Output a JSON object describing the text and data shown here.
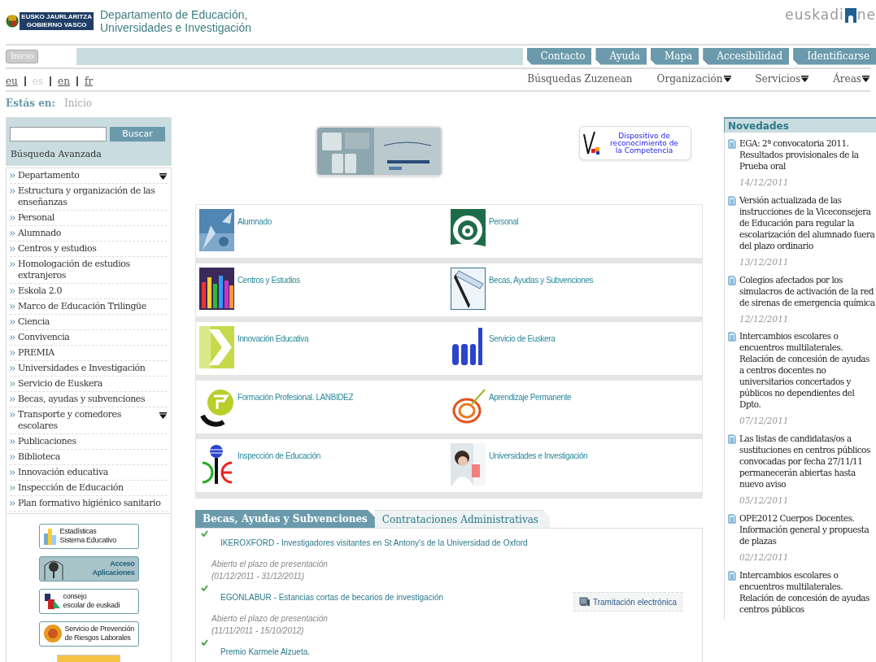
{
  "header": {
    "logo_lines": [
      "EUSKO JAURLARITZA",
      "GOBIERNO VASCO"
    ],
    "title_lines": [
      "Departamento de Educación,",
      "Universidades e Investigación"
    ],
    "brand": [
      "euskadi",
      "ne"
    ]
  },
  "top_nav": {
    "home": "Inicio",
    "links": [
      "Contacto",
      "Ayuda",
      "Mapa",
      "Accesibilidad",
      "Identificarse"
    ]
  },
  "languages": [
    {
      "label": "eu",
      "selected": false
    },
    {
      "label": "es",
      "selected": true
    },
    {
      "label": "en",
      "selected": false
    },
    {
      "label": "fr",
      "selected": false
    }
  ],
  "secondary_nav": [
    {
      "label": "Búsquedas Zuzenean",
      "dropdown": false
    },
    {
      "label": "Organización",
      "dropdown": true
    },
    {
      "label": "Servicios",
      "dropdown": true
    },
    {
      "label": "Áreas",
      "dropdown": true
    }
  ],
  "breadcrumb": {
    "label": "Estás en:",
    "items": [
      "Inicio"
    ]
  },
  "search": {
    "button": "Buscar",
    "advanced": "Búsqueda Avanzada"
  },
  "sidebar": {
    "items": [
      {
        "label": "Departamento",
        "dropdown": true
      },
      {
        "label": "Estructura y organización de las enseñanzas",
        "dropdown": false
      },
      {
        "label": "Personal",
        "dropdown": false
      },
      {
        "label": "Alumnado",
        "dropdown": false
      },
      {
        "label": "Centros y estudios",
        "dropdown": false
      },
      {
        "label": "Homologación de estudios extranjeros",
        "dropdown": false
      },
      {
        "label": "Eskola 2.0",
        "dropdown": false
      },
      {
        "label": "Marco de Educación Trilingüe",
        "dropdown": false
      },
      {
        "label": "Ciencia",
        "dropdown": false
      },
      {
        "label": "Convivencia",
        "dropdown": false
      },
      {
        "label": "PREMIA",
        "dropdown": false
      },
      {
        "label": "Universidades e Investigación",
        "dropdown": false
      },
      {
        "label": "Servicio de Euskera",
        "dropdown": false
      },
      {
        "label": "Becas, ayudas y subvenciones",
        "dropdown": false
      },
      {
        "label": "Transporte y comedores escolares",
        "dropdown": true
      },
      {
        "label": "Publicaciones",
        "dropdown": false
      },
      {
        "label": "Biblioteca",
        "dropdown": false
      },
      {
        "label": "Innovación educativa",
        "dropdown": false
      },
      {
        "label": "Inspección de Educación",
        "dropdown": false
      },
      {
        "label": "Plan formativo higiénico sanitario",
        "dropdown": false
      }
    ]
  },
  "side_banners": [
    {
      "kind": "stats",
      "lines": [
        "Estadísticas",
        "Sistema Educativo"
      ]
    },
    {
      "kind": "access",
      "lines": [
        "Acceso",
        "Aplicaciones"
      ]
    },
    {
      "kind": "council",
      "lines": [
        "consejo",
        "escolar de euskadi"
      ]
    },
    {
      "kind": "prevention",
      "lines": [
        "Servicio de Prevención",
        "de Riesgos Laborales"
      ]
    },
    {
      "kind": "partial"
    }
  ],
  "center_banners": [
    {
      "kind": "picture"
    },
    {
      "kind": "text",
      "lines": [
        "Dispositivo de",
        "reconocimiento de",
        "la Competencia"
      ]
    }
  ],
  "categories": [
    {
      "label": "Alumnado",
      "kind": "hands"
    },
    {
      "label": "Personal",
      "kind": "at"
    },
    {
      "label": "Centros y Estudios",
      "kind": "pencils"
    },
    {
      "label": "Becas, Ayudas y Subvenciones",
      "kind": "pen"
    },
    {
      "label": "Innovación Educativa",
      "kind": "arrow"
    },
    {
      "label": "Servicio de Euskera",
      "kind": "letters"
    },
    {
      "label": "Formación Profesional. LANBIDEZ",
      "kind": "ring"
    },
    {
      "label": "Aprendizaje Permanente",
      "kind": "scribble"
    },
    {
      "label": "Inspección de Educación",
      "kind": "emblem"
    },
    {
      "label": "Universidades e Investigación",
      "kind": "lab"
    }
  ],
  "tabs": [
    {
      "label": "Becas, Ayudas y Subvenciones",
      "selected": true
    },
    {
      "label": "Contrataciones Administrativas",
      "selected": false
    }
  ],
  "grants": [
    {
      "title": "IKEROXFORD - Investigadores visitantes en St Antony's de la Universidad de Oxford",
      "status": "Abierto el plazo de presentación",
      "dates": "(01/12/2011 - 31/12/2011)"
    },
    {
      "title": "EGONLABUR - Estancias cortas de becarios de investigación",
      "status": "Abierto el plazo de presentación",
      "dates": "(11/11/2011 - 15/10/2012)",
      "action": "Tramitación electrónica"
    },
    {
      "title": "Premio Karmele Alzueta."
    }
  ],
  "news": {
    "title": "Novedades",
    "items": [
      {
        "text": "EGA: 2ª convocatoria 2011. Resultados provisionales de la Prueba oral",
        "date": "14/12/2011"
      },
      {
        "text": "Versión actualizada de las instrucciones de la Viceconsejera de Educación para regular la escolarización del alumnado fuera del plazo ordinario",
        "date": "13/12/2011"
      },
      {
        "text": "Colegios afectados por los simulacros de activación de la red de sirenas de emergencia química",
        "date": "12/12/2011"
      },
      {
        "text": "Intercambios escolares o encuentros multilaterales. Relación de concesión de ayudas a centros docentes no universitarios concertados y públicos no dependientes del Dpto.",
        "date": "07/12/2011"
      },
      {
        "text": "Las listas de candidatas/os a sustituciones en centros públicos convocadas por fecha 27/11/11 permanecerán abiertas hasta nuevo aviso",
        "date": "05/12/2011"
      },
      {
        "text": "OPE2012 Cuerpos Docentes. Información general y propuesta de plazas",
        "date": "02/12/2011"
      },
      {
        "text": "Intercambios escolares o encuentros multilaterales. Relación de concesión de ayudas centros públicos"
      }
    ]
  }
}
